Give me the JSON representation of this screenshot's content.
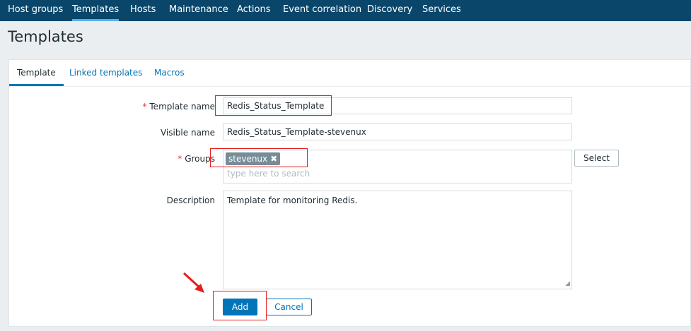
{
  "nav": {
    "items": [
      "Host groups",
      "Templates",
      "Hosts",
      "Maintenance",
      "Actions",
      "Event correlation",
      "Discovery",
      "Services"
    ],
    "active": "Templates"
  },
  "page": {
    "title": "Templates"
  },
  "tabs": [
    "Template",
    "Linked templates",
    "Macros"
  ],
  "form": {
    "template_name_label": "Template name",
    "template_name_value": "Redis_Status_Template",
    "visible_name_label": "Visible name",
    "visible_name_value": "Redis_Status_Template-stevenux",
    "groups_label": "Groups",
    "group_tag": "stevenux",
    "group_remove": "✖",
    "groups_placeholder": "type here to search",
    "select_button": "Select",
    "description_label": "Description",
    "description_value": "Template for monitoring Redis.",
    "required_mark": "*",
    "add_button": "Add",
    "cancel_button": "Cancel"
  },
  "colors": {
    "nav_bg": "#0a466a",
    "accent": "#0275b8",
    "annotation": "#e31e1e"
  }
}
